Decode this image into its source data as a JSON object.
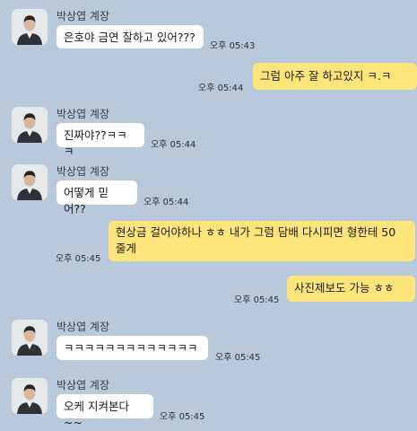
{
  "chat": {
    "sender_name": "박상엽 계장",
    "messages": [
      {
        "direction": "in",
        "text": "은호야 금연 잘하고 있어???",
        "time": "오후 05:43"
      },
      {
        "direction": "out",
        "text": "그럼 아주 잘 하고있지 ㅋ.ㅋ",
        "time": "오후 05:44"
      },
      {
        "direction": "in",
        "text": "진짜야??ㅋㅋㅋ",
        "time": "오후 05:44"
      },
      {
        "direction": "in",
        "text": "어떻게 믿어??",
        "time": "오후 05:44"
      },
      {
        "direction": "out",
        "text": "현상금 걸어야하나 ㅎㅎ 내가 그럼 담배 다시피면 형한테 50 줄게",
        "time": "오후 05:45"
      },
      {
        "direction": "out",
        "text": "사진제보도 가능 ㅎㅎ",
        "time": "오후 05:45"
      },
      {
        "direction": "in",
        "text": "ㅋㅋㅋㅋㅋㅋㅋㅋㅋㅋㅋㅋㅋ",
        "time": "오후 05:45"
      },
      {
        "direction": "in",
        "text": "오케 지켜본다~~",
        "time": "오후 05:45"
      }
    ]
  },
  "colors": {
    "background": "#b9c9dc",
    "incoming_bubble": "#ffffff",
    "outgoing_bubble": "#fde57c"
  }
}
